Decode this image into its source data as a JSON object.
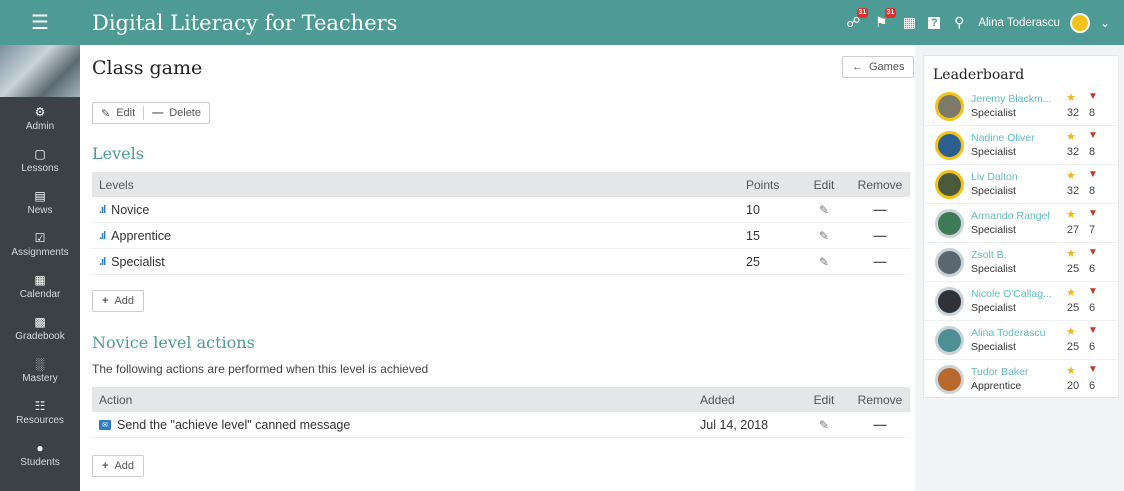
{
  "topbar": {
    "menu_icon": "hamburger-menu-icon",
    "title": "Digital Literacy for Teachers",
    "badge_1": "31",
    "badge_2": "31",
    "user_name": "Alina Toderascu",
    "colors": {
      "topbar": "#4e9a94",
      "badge": "#d9332b"
    }
  },
  "sidebar": {
    "items": [
      {
        "label": "Admin",
        "icon": "gear-icon"
      },
      {
        "label": "Lessons",
        "icon": "lessons-icon"
      },
      {
        "label": "News",
        "icon": "news-icon"
      },
      {
        "label": "Assignments",
        "icon": "assignments-icon"
      },
      {
        "label": "Calendar",
        "icon": "calendar-icon"
      },
      {
        "label": "Gradebook",
        "icon": "gradebook-icon"
      },
      {
        "label": "Mastery",
        "icon": "mastery-icon"
      },
      {
        "label": "Resources",
        "icon": "resources-icon"
      },
      {
        "label": "Students",
        "icon": "students-icon"
      }
    ]
  },
  "page": {
    "title": "Class game",
    "games_button": "Games",
    "edit_button": "Edit",
    "delete_button": "Delete"
  },
  "levels": {
    "section_title": "Levels",
    "headers": {
      "name": "Levels",
      "points": "Points",
      "edit": "Edit",
      "remove": "Remove"
    },
    "rows": [
      {
        "name": "Novice",
        "points": "10"
      },
      {
        "name": "Apprentice",
        "points": "15"
      },
      {
        "name": "Specialist",
        "points": "25"
      }
    ],
    "add_button": "Add"
  },
  "actions": {
    "section_title": "Novice level actions",
    "description": "The following actions are performed when this level is achieved",
    "headers": {
      "action": "Action",
      "added": "Added",
      "edit": "Edit",
      "remove": "Remove"
    },
    "rows": [
      {
        "action": "Send the \"achieve level\" canned message",
        "added": "Jul 14, 2018"
      }
    ],
    "add_button": "Add"
  },
  "leaderboard": {
    "title": "Leaderboard",
    "entries": [
      {
        "name": "Jeremy Blackm...",
        "level": "Specialist",
        "points": "32",
        "badges": "8"
      },
      {
        "name": "Nadine Oliver",
        "level": "Specialist",
        "points": "32",
        "badges": "8"
      },
      {
        "name": "Liv Dalton",
        "level": "Specialist",
        "points": "32",
        "badges": "8"
      },
      {
        "name": "Armando Rangel",
        "level": "Specialist",
        "points": "27",
        "badges": "7"
      },
      {
        "name": "Zsolt B.",
        "level": "Specialist",
        "points": "25",
        "badges": "6"
      },
      {
        "name": "Nicole O'Callag...",
        "level": "Specialist",
        "points": "25",
        "badges": "6"
      },
      {
        "name": "Alina Toderascu",
        "level": "Specialist",
        "points": "25",
        "badges": "6"
      },
      {
        "name": "Tudor Baker",
        "level": "Apprentice",
        "points": "20",
        "badges": "6"
      }
    ]
  }
}
